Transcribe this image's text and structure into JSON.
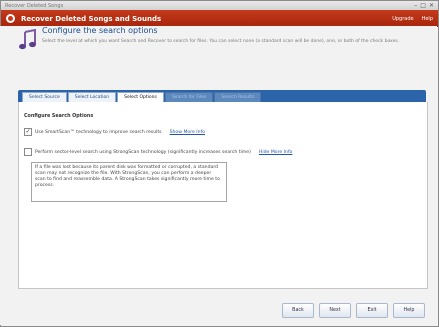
{
  "window": {
    "title": "Recover Deleted Songs",
    "controls": [
      "–",
      "□",
      "✕"
    ]
  },
  "appbar": {
    "title": "Recover Deleted Songs and Sounds",
    "links": [
      "Upgrade",
      "Help"
    ]
  },
  "header": {
    "title": "Configure the search options",
    "description": "Select the level at which you want Search and Recover to search for files. You can select none (a standard scan will be done), one, or both of the check boxes."
  },
  "tabs": [
    {
      "label": "Select Source",
      "state": "normal"
    },
    {
      "label": "Select Location",
      "state": "normal"
    },
    {
      "label": "Select Options",
      "state": "active"
    },
    {
      "label": "Search for Files",
      "state": "disabled"
    },
    {
      "label": "Search Results",
      "state": "disabled"
    }
  ],
  "section_title": "Configure Search Options",
  "options": [
    {
      "label": "Use SmartScan™ technology to improve search results",
      "checked": true,
      "link": "Show More Info"
    },
    {
      "label": "Perform sector-level search using StrongScan technology (significantly increases search time)",
      "checked": false,
      "link": "Hide More Info"
    }
  ],
  "info_box": "If a file was lost because its parent disk was formatted or corrupted, a standard scan may not recognize the file. With StrongScan, you can perform a deeper scan to find and reassemble data. A StrongScan takes significantly more time to process.",
  "buttons": {
    "back": "Back",
    "next": "Next",
    "exit": "Exit",
    "help": "Help"
  },
  "colors": {
    "app_bar": "#b72e12",
    "tab_bar": "#2b64a8",
    "title_text": "#1d4e8f",
    "link": "#2255aa"
  }
}
